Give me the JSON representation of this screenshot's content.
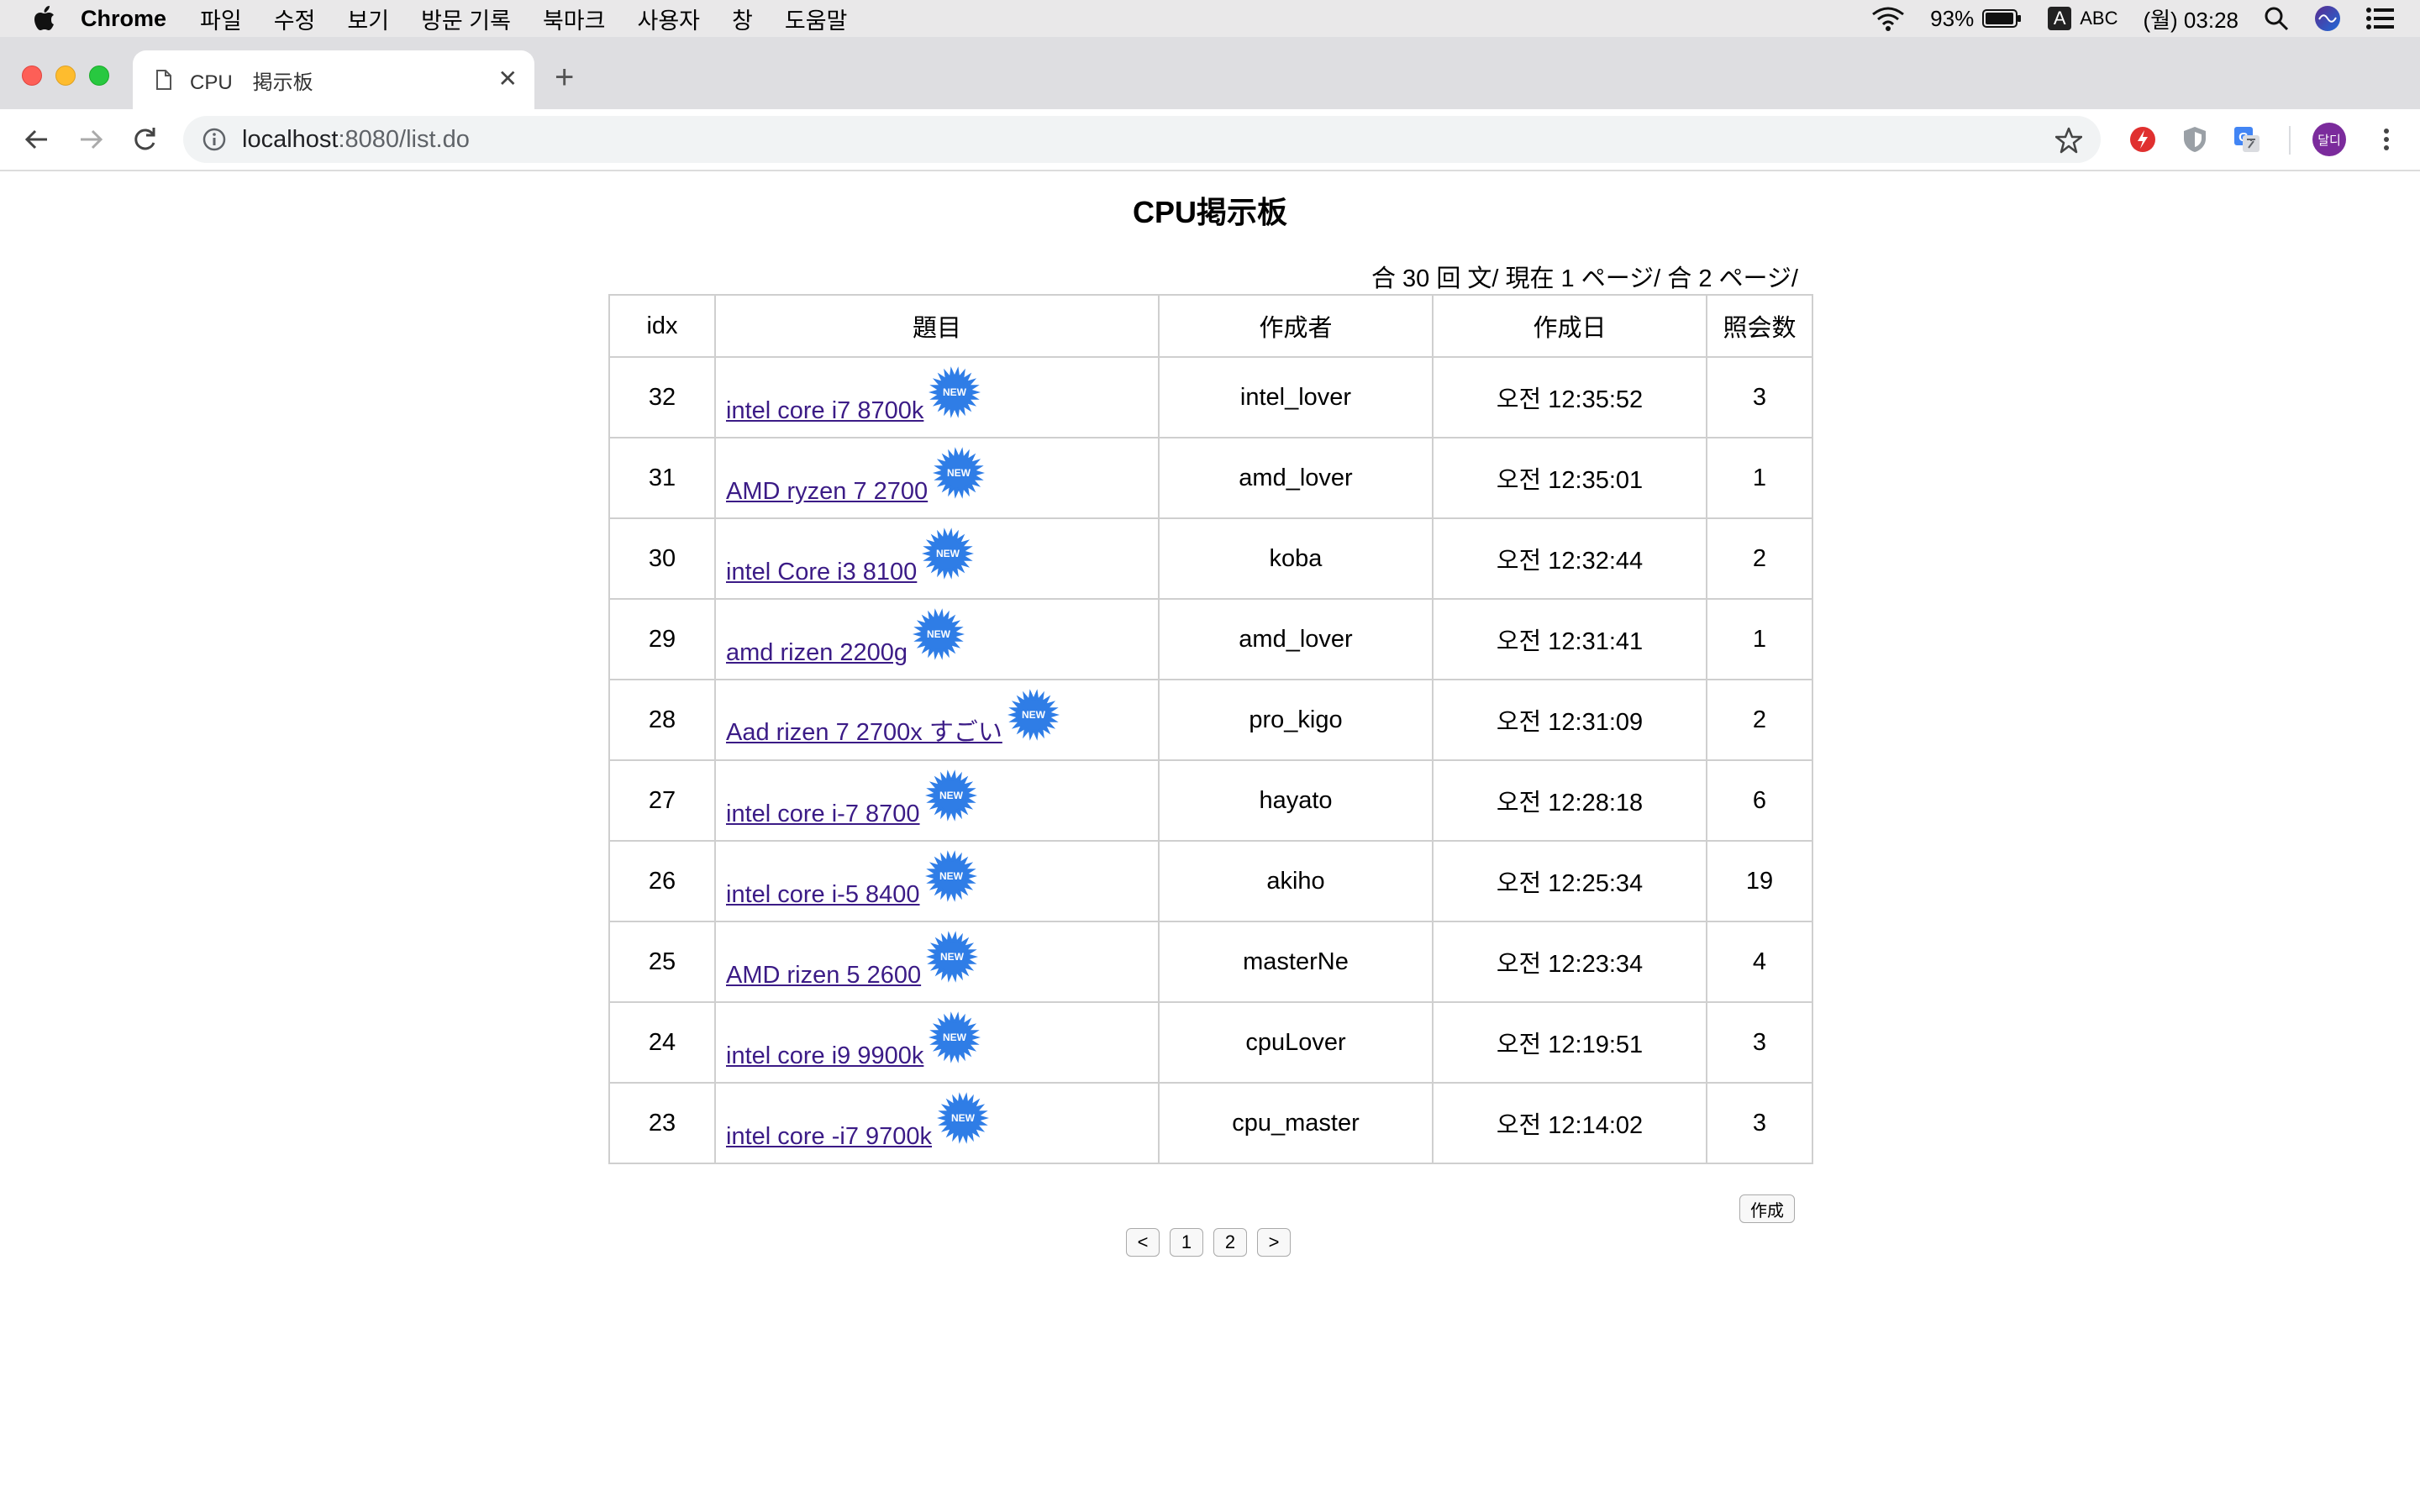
{
  "menubar": {
    "app": "Chrome",
    "items": [
      "파일",
      "수정",
      "보기",
      "방문 기록",
      "북마크",
      "사용자",
      "창",
      "도움말"
    ],
    "battery": "93%",
    "input_source": "ABC",
    "clock": "(월) 03:28"
  },
  "browser": {
    "tab_title": "CPU　掲示板",
    "url_host": "localhost",
    "url_path": ":8080/list.do",
    "profile_label": "달디"
  },
  "board": {
    "title": "CPU掲示板",
    "summary": "合 30 回 文/ 現在 1 ページ/ 合 2 ページ/",
    "headers": {
      "idx": "idx",
      "title": "題目",
      "writer": "作成者",
      "date": "作成日",
      "views": "照会数"
    },
    "rows": [
      {
        "idx": "32",
        "title": "intel core i7 8700k",
        "writer": "intel_lover",
        "date": "오전 12:35:52",
        "views": "3"
      },
      {
        "idx": "31",
        "title": "AMD ryzen 7 2700",
        "writer": "amd_lover",
        "date": "오전 12:35:01",
        "views": "1"
      },
      {
        "idx": "30",
        "title": "intel Core i3 8100",
        "writer": "koba",
        "date": "오전 12:32:44",
        "views": "2"
      },
      {
        "idx": "29",
        "title": "amd rizen 2200g",
        "writer": "amd_lover",
        "date": "오전 12:31:41",
        "views": "1"
      },
      {
        "idx": "28",
        "title": "Aad rizen 7 2700x すごい",
        "writer": "pro_kigo",
        "date": "오전 12:31:09",
        "views": "2"
      },
      {
        "idx": "27",
        "title": "intel core i-7 8700",
        "writer": "hayato",
        "date": "오전 12:28:18",
        "views": "6"
      },
      {
        "idx": "26",
        "title": "intel core i-5 8400",
        "writer": "akiho",
        "date": "오전 12:25:34",
        "views": "19"
      },
      {
        "idx": "25",
        "title": "AMD rizen 5 2600",
        "writer": "masterNe",
        "date": "오전 12:23:34",
        "views": "4"
      },
      {
        "idx": "24",
        "title": "intel core i9 9900k",
        "writer": "cpuLover",
        "date": "오전 12:19:51",
        "views": "3"
      },
      {
        "idx": "23",
        "title": "intel core -i7 9700k",
        "writer": "cpu_master",
        "date": "오전 12:14:02",
        "views": "3"
      }
    ],
    "write_button": "作成",
    "pagination": [
      "<",
      "1",
      "2",
      ">"
    ]
  },
  "colors": {
    "link": "#3b1b86",
    "badge_blue": "#2f7de6",
    "menubar_bg": "#e9e8e9",
    "tabstrip_bg": "#dedee1"
  },
  "icons": [
    "apple-icon",
    "wifi-icon",
    "battery-icon",
    "search-icon",
    "siri-icon",
    "notification-icon",
    "document-icon",
    "close-icon",
    "plus-icon",
    "back-icon",
    "forward-icon",
    "reload-icon",
    "info-icon",
    "star-icon",
    "new-badge-icon"
  ]
}
